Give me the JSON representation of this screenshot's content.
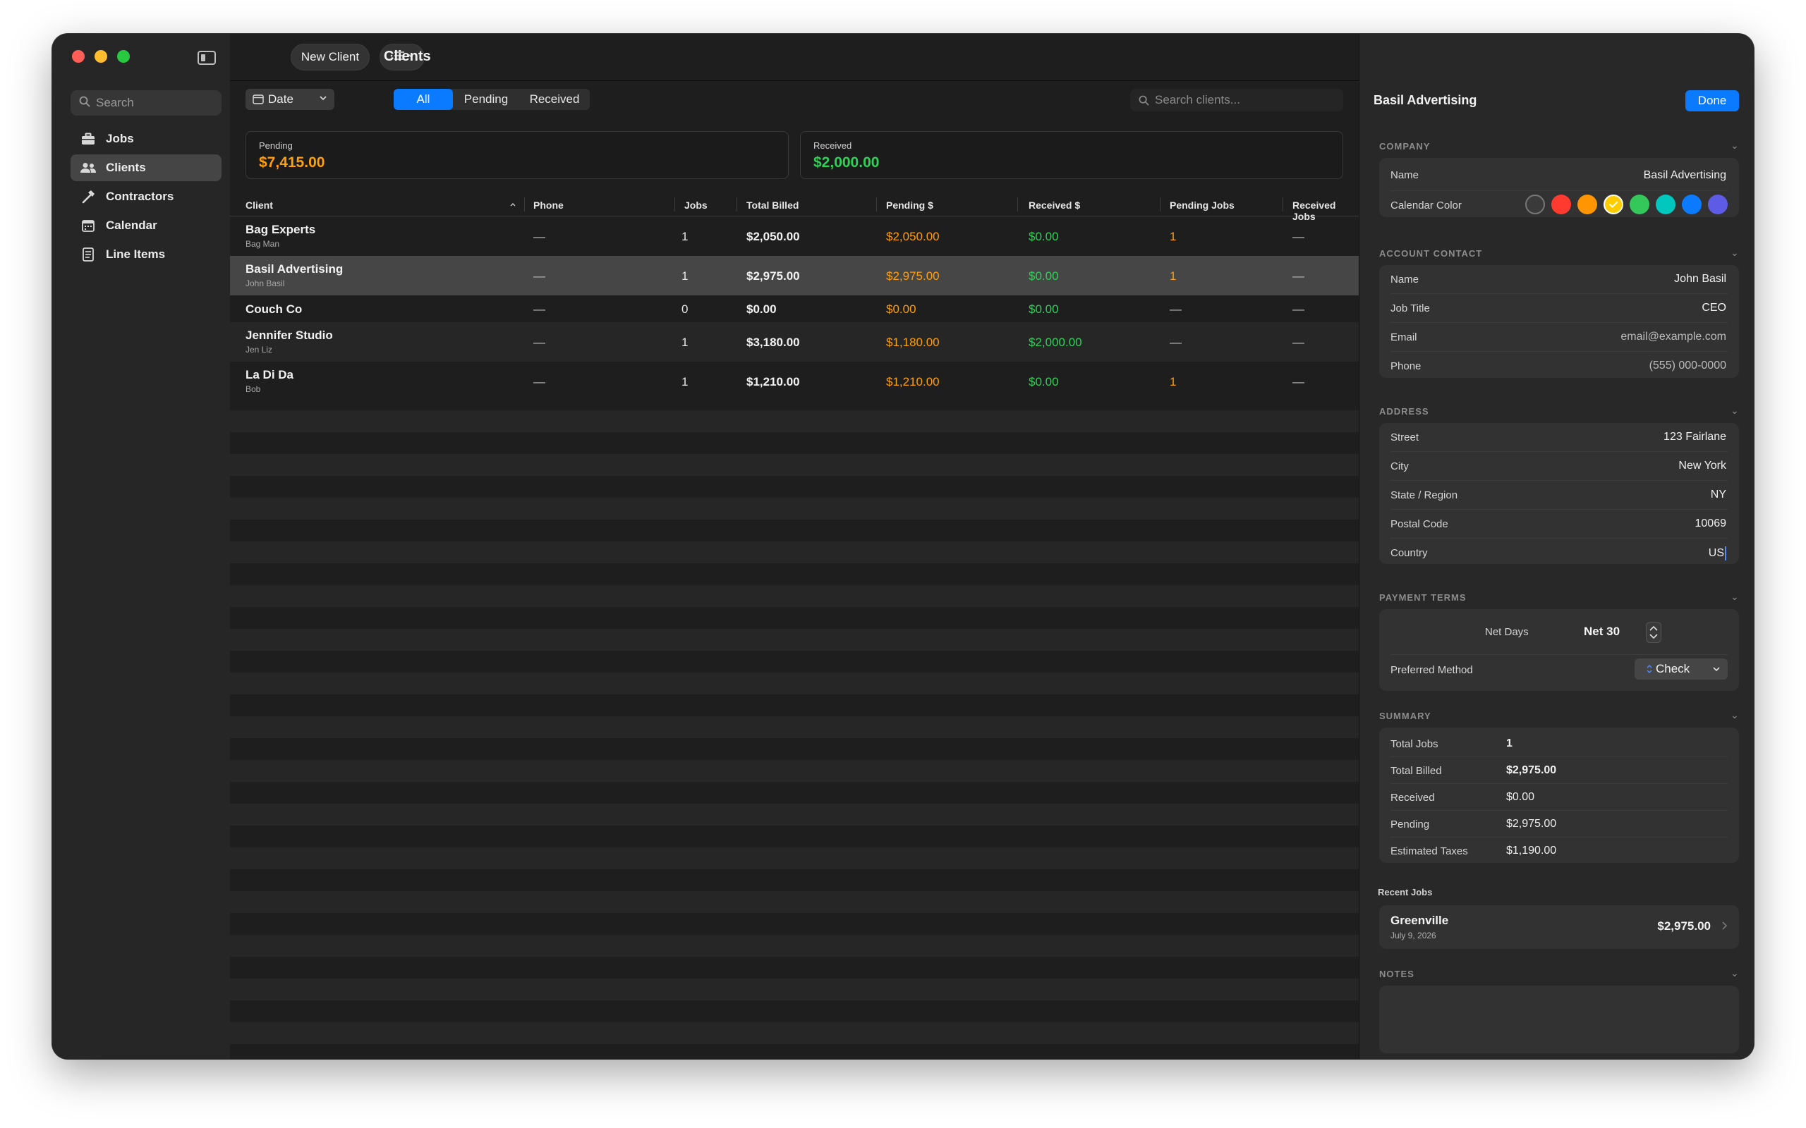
{
  "sidebar": {
    "search_placeholder": "Search",
    "items": [
      {
        "label": "Jobs",
        "icon": "briefcase-icon"
      },
      {
        "label": "Clients",
        "icon": "people-icon",
        "active": true
      },
      {
        "label": "Contractors",
        "icon": "hammer-icon"
      },
      {
        "label": "Calendar",
        "icon": "calendar-icon"
      },
      {
        "label": "Line Items",
        "icon": "document-list-icon"
      }
    ]
  },
  "toolbar": {
    "new_client_label": "New Client",
    "title": "Clients"
  },
  "filters": {
    "date_label": "Date",
    "segments": [
      "All",
      "Pending",
      "Received"
    ],
    "search_placeholder": "Search clients..."
  },
  "cards": {
    "pending_label": "Pending",
    "pending_value": "$7,415.00",
    "received_label": "Received",
    "received_value": "$2,000.00"
  },
  "table": {
    "columns": [
      "Client",
      "Phone",
      "Jobs",
      "Total Billed",
      "Pending $",
      "Received $",
      "Pending Jobs",
      "Received Jobs"
    ],
    "rows": [
      {
        "name": "Bag Experts",
        "contact": "Bag Man",
        "phone": "—",
        "jobs": "1",
        "total": "$2,050.00",
        "pending": "$2,050.00",
        "received": "$0.00",
        "pending_jobs": "1",
        "received_jobs": "—"
      },
      {
        "name": "Basil Advertising",
        "contact": "John Basil",
        "phone": "—",
        "jobs": "1",
        "total": "$2,975.00",
        "pending": "$2,975.00",
        "received": "$0.00",
        "pending_jobs": "1",
        "received_jobs": "—"
      },
      {
        "name": "Couch Co",
        "contact": "",
        "phone": "—",
        "jobs": "0",
        "total": "$0.00",
        "pending": "$0.00",
        "received": "$0.00",
        "pending_jobs": "—",
        "received_jobs": "—"
      },
      {
        "name": "Jennifer Studio",
        "contact": "Jen Liz",
        "phone": "—",
        "jobs": "1",
        "total": "$3,180.00",
        "pending": "$1,180.00",
        "received": "$2,000.00",
        "pending_jobs": "—",
        "received_jobs": "—"
      },
      {
        "name": "La Di Da",
        "contact": "Bob",
        "phone": "—",
        "jobs": "1",
        "total": "$1,210.00",
        "pending": "$1,210.00",
        "received": "$0.00",
        "pending_jobs": "1",
        "received_jobs": "—"
      }
    ]
  },
  "inspector": {
    "title": "Basil Advertising",
    "done_label": "Done",
    "company": {
      "section": "COMPANY",
      "name_label": "Name",
      "name_value": "Basil Advertising",
      "color_label": "Calendar Color",
      "colors": [
        "#3a3a3a",
        "#ff3b30",
        "#ff9500",
        "#ffcc00",
        "#34c759",
        "#00c7be",
        "#0a7aff",
        "#5e5ce6"
      ]
    },
    "contact": {
      "section": "ACCOUNT CONTACT",
      "fields": [
        {
          "label": "Name",
          "value": "John Basil"
        },
        {
          "label": "Job Title",
          "value": "CEO"
        },
        {
          "label": "Email",
          "value": "email@example.com"
        },
        {
          "label": "Phone",
          "value": "(555) 000-0000"
        }
      ]
    },
    "address": {
      "section": "ADDRESS",
      "fields": [
        {
          "label": "Street",
          "value": "123 Fairlane"
        },
        {
          "label": "City",
          "value": "New York"
        },
        {
          "label": "State / Region",
          "value": "NY"
        },
        {
          "label": "Postal Code",
          "value": "10069"
        },
        {
          "label": "Country",
          "value": "US"
        }
      ]
    },
    "payment": {
      "section": "PAYMENT TERMS",
      "net_days_label": "Net Days",
      "net_days_value": "Net 30",
      "method_label": "Preferred Method",
      "method_value": "Check"
    },
    "summary": {
      "section": "SUMMARY",
      "rows": [
        {
          "label": "Total Jobs",
          "value": "1"
        },
        {
          "label": "Total Billed",
          "value": "$2,975.00"
        },
        {
          "label": "Received",
          "value": "$0.00"
        },
        {
          "label": "Pending",
          "value": "$2,975.00"
        },
        {
          "label": "Estimated Taxes",
          "value": "$1,190.00"
        }
      ]
    },
    "recent_jobs": {
      "section": "Recent Jobs",
      "jobs": [
        {
          "name": "Greenville",
          "date": "July 9, 2026",
          "amount": "$2,975.00"
        }
      ]
    },
    "notes": {
      "section": "NOTES"
    }
  }
}
